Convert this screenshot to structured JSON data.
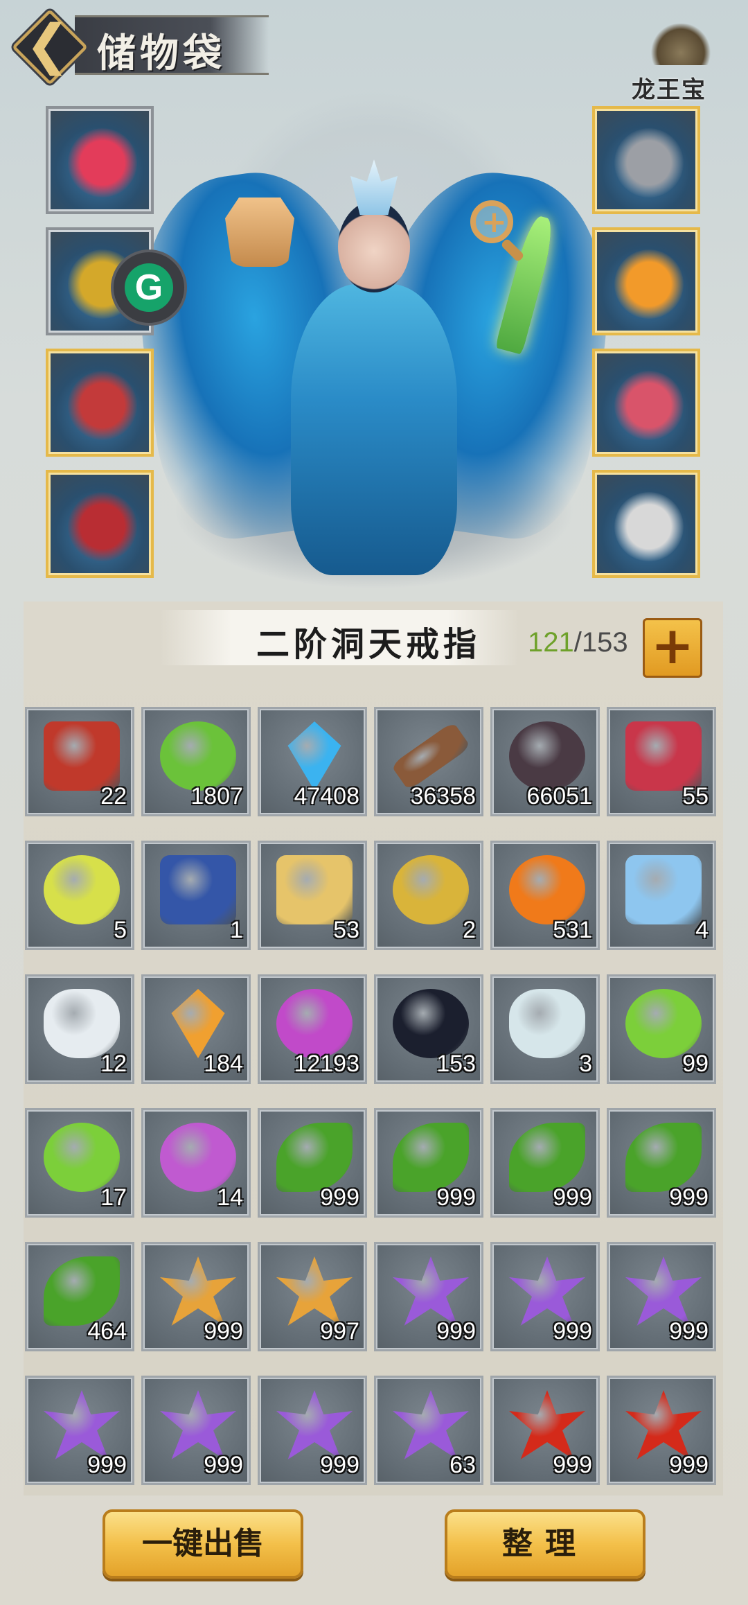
{
  "header": {
    "title": "储物袋",
    "logo_text": "龙王宝库"
  },
  "character": {
    "left_slots": [
      {
        "name": "sword",
        "color": "#e33c5a"
      },
      {
        "name": "helmet",
        "color": "#d4a82a"
      },
      {
        "name": "chest-armor",
        "color": "#c33a3a"
      },
      {
        "name": "boots",
        "color": "#b92d33"
      }
    ],
    "right_slots": [
      {
        "name": "armlet",
        "color": "#9c9fa5"
      },
      {
        "name": "pendant",
        "color": "#f29a2a"
      },
      {
        "name": "ring",
        "color": "#d9546a"
      },
      {
        "name": "shield-charm",
        "color": "#d8d8d8"
      }
    ]
  },
  "bag": {
    "title": "二阶洞天戒指",
    "capacity_used": "121",
    "capacity_sep": "/",
    "capacity_total": "153",
    "items": [
      {
        "icon": "token-plaque-icon",
        "count": "22",
        "color": "#c0392b"
      },
      {
        "icon": "jade-dragon-icon",
        "count": "1807",
        "color": "#6bc23a"
      },
      {
        "icon": "blue-crystal-icon",
        "count": "47408",
        "color": "#3bb3f0"
      },
      {
        "icon": "wood-log-icon",
        "count": "36358",
        "color": "#8a5a3a"
      },
      {
        "icon": "dark-ore-icon",
        "count": "66051",
        "color": "#4a3a44"
      },
      {
        "icon": "red-shield-icon",
        "count": "55",
        "color": "#c9364a"
      },
      {
        "icon": "yellow-orb-icon",
        "count": "5",
        "color": "#d7e04a"
      },
      {
        "icon": "blue-book-icon",
        "count": "1",
        "color": "#3456a8"
      },
      {
        "icon": "gold-giftbox-icon",
        "count": "53",
        "color": "#e6c46a"
      },
      {
        "icon": "gold-pouch-icon",
        "count": "2",
        "color": "#d9b43a"
      },
      {
        "icon": "fire-orb-icon",
        "count": "531",
        "color": "#f07a1a"
      },
      {
        "icon": "blue-giftbox-icon",
        "count": "4",
        "color": "#8ec6ef"
      },
      {
        "icon": "white-vase-icon",
        "count": "12",
        "color": "#e6ecf0"
      },
      {
        "icon": "amber-shard-icon",
        "count": "184",
        "color": "#f0a030"
      },
      {
        "icon": "purple-orb-icon",
        "count": "12193",
        "color": "#c14ac9"
      },
      {
        "icon": "black-pearl-icon",
        "count": "153",
        "color": "#1b1f2e"
      },
      {
        "icon": "potion-flask-icon",
        "count": "3",
        "color": "#d6e6ea"
      },
      {
        "icon": "green-orb-icon",
        "count": "99",
        "color": "#7ccf3a"
      },
      {
        "icon": "green-orb-icon",
        "count": "17",
        "color": "#7ccf3a"
      },
      {
        "icon": "violet-core-icon",
        "count": "14",
        "color": "#c05ad0"
      },
      {
        "icon": "green-herb-icon",
        "count": "999",
        "color": "#4aa32a"
      },
      {
        "icon": "green-herb-icon",
        "count": "999",
        "color": "#4aa32a"
      },
      {
        "icon": "green-herb-icon",
        "count": "999",
        "color": "#4aa32a"
      },
      {
        "icon": "green-herb-icon",
        "count": "999",
        "color": "#4aa32a"
      },
      {
        "icon": "green-herb-icon",
        "count": "464",
        "color": "#4aa32a"
      },
      {
        "icon": "orange-lily-icon",
        "count": "999",
        "color": "#e7a33a"
      },
      {
        "icon": "orange-lily-icon",
        "count": "997",
        "color": "#e7a33a"
      },
      {
        "icon": "purple-flower-icon",
        "count": "999",
        "color": "#9a5ad9"
      },
      {
        "icon": "purple-flower-icon",
        "count": "999",
        "color": "#9a5ad9"
      },
      {
        "icon": "purple-flower-icon",
        "count": "999",
        "color": "#9a5ad9"
      },
      {
        "icon": "purple-flower-icon",
        "count": "999",
        "color": "#9a5ad9"
      },
      {
        "icon": "purple-flower-icon",
        "count": "999",
        "color": "#9a5ad9"
      },
      {
        "icon": "purple-flower-icon",
        "count": "999",
        "color": "#9a5ad9"
      },
      {
        "icon": "purple-flower-icon",
        "count": "63",
        "color": "#9a5ad9"
      },
      {
        "icon": "red-flower-icon",
        "count": "999",
        "color": "#d42a1a"
      },
      {
        "icon": "red-flower-icon",
        "count": "999",
        "color": "#d42a1a"
      }
    ]
  },
  "buttons": {
    "sell_all": "一键出售",
    "sort": "整理"
  }
}
